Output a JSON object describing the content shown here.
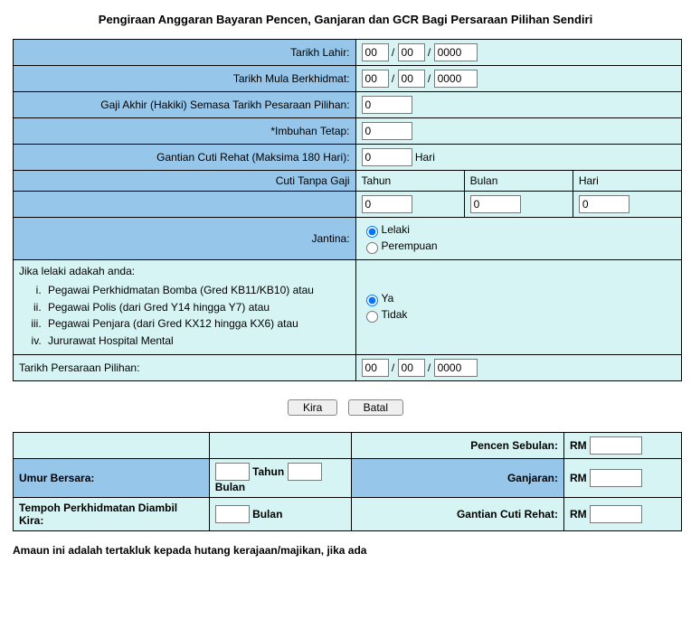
{
  "title": "Pengiraan Anggaran Bayaran Pencen, Ganjaran dan GCR Bagi Persaraan Pilihan Sendiri",
  "labels": {
    "tarikh_lahir": "Tarikh Lahir:",
    "tarikh_mula": "Tarikh Mula Berkhidmat:",
    "gaji_akhir": "Gaji Akhir (Hakiki) Semasa Tarikh Pesaraan Pilihan:",
    "imbuhan": "*Imbuhan Tetap:",
    "gcr": "Gantian Cuti Rehat (Maksima 180 Hari):",
    "hari": "Hari",
    "cuti_tanpa_gaji": "Cuti Tanpa Gaji",
    "tahun": "Tahun",
    "bulan": "Bulan",
    "jantina": "Jantina:",
    "lelaki": "Lelaki",
    "perempuan": "Perempuan",
    "jika_header": "Jika lelaki adakah anda:",
    "jika_items": {
      "i": "Pegawai Perkhidmatan Bomba (Gred KB11/KB10) atau",
      "ii": "Pegawai Polis (dari Gred Y14 hingga Y7) atau",
      "iii": "Pegawai Penjara (dari Gred KX12 hingga KX6) atau",
      "iv": "Jururawat Hospital Mental"
    },
    "ya": "Ya",
    "tidak": "Tidak",
    "tarikh_persaraan": "Tarikh Persaraan Pilihan:",
    "btn_kira": "Kira",
    "btn_batal": "Batal",
    "pencen_sebulan": "Pencen Sebulan:",
    "umur_bersara": "Umur Bersara:",
    "ganjaran": "Ganjaran:",
    "tempoh": "Tempoh Perkhidmatan Diambil Kira:",
    "gantian_cuti": "Gantian Cuti Rehat:",
    "rm": "RM",
    "tahun_word": "Tahun",
    "bulan_word": "Bulan"
  },
  "values": {
    "lahir_dd": "00",
    "lahir_mm": "00",
    "lahir_yyyy": "0000",
    "mula_dd": "00",
    "mula_mm": "00",
    "mula_yyyy": "0000",
    "gaji": "0",
    "imbuhan": "0",
    "gcr": "0",
    "ctg_tahun": "0",
    "ctg_bulan": "0",
    "ctg_hari": "0",
    "persaraan_dd": "00",
    "persaraan_mm": "00",
    "persaraan_yyyy": "0000",
    "umur_tahun": "",
    "umur_bulan": "",
    "tempoh_bulan": "",
    "pencen_rm": "",
    "ganjaran_rm": "",
    "gcr_rm": ""
  },
  "footer": "Amaun ini adalah tertakluk kepada hutang kerajaan/majikan, jika ada"
}
